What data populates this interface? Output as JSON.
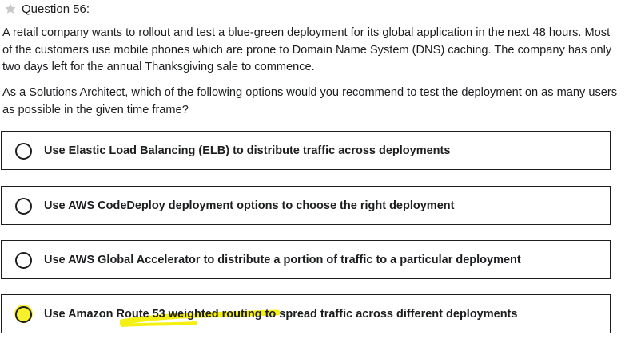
{
  "question": {
    "title": "Question 56:",
    "paragraph1": "A retail company wants to rollout and test a blue-green deployment for its global application in the next 48 hours. Most of the customers use mobile phones which are prone to Domain Name System (DNS) caching. The company has only two days left for the annual Thanksgiving sale to commence.",
    "paragraph2": "As a Solutions Architect, which of the following options would you recommend to test the deployment on as many users as possible in the given time frame?"
  },
  "options": [
    {
      "label": "Use Elastic Load Balancing (ELB) to distribute traffic across deployments"
    },
    {
      "label": "Use AWS CodeDeploy deployment options to choose the right deployment"
    },
    {
      "label": "Use AWS Global Accelerator to distribute a portion of traffic to a particular deployment"
    },
    {
      "label": "Use Amazon Route 53 weighted routing to spread traffic across different deployments"
    }
  ],
  "colors": {
    "text": "#1c1d1f",
    "border": "#1c1d1f",
    "star": "#c9c9c9",
    "highlight": "#f5f013"
  },
  "icons": {
    "flag": "star-icon",
    "radio": "radio-circle"
  }
}
